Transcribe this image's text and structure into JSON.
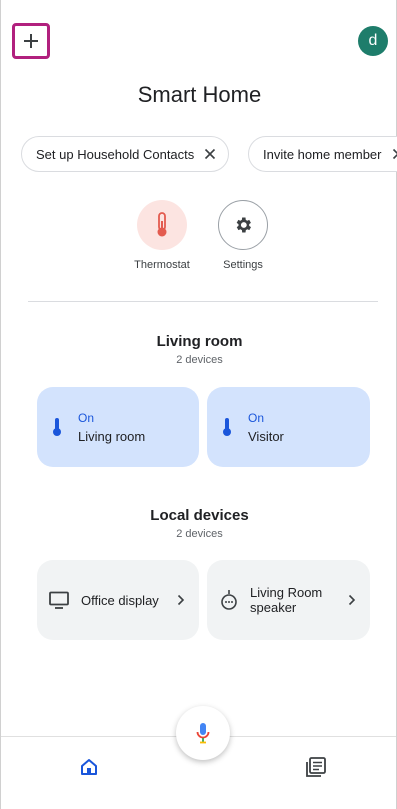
{
  "header": {
    "title": "Smart Home",
    "avatar_initial": "d"
  },
  "chips": [
    {
      "label": "Set up Household Contacts"
    },
    {
      "label": "Invite home member"
    }
  ],
  "shortcuts": [
    {
      "label": "Thermostat",
      "icon": "thermometer-icon"
    },
    {
      "label": "Settings",
      "icon": "gear-icon"
    }
  ],
  "rooms": [
    {
      "title": "Living room",
      "subtitle": "2 devices",
      "devices": [
        {
          "state": "On",
          "name": "Living room",
          "icon": "thermometer-icon"
        },
        {
          "state": "On",
          "name": "Visitor",
          "icon": "thermometer-icon"
        }
      ]
    },
    {
      "title": "Local devices",
      "subtitle": "2 devices",
      "devices": [
        {
          "name": "Office display",
          "icon": "monitor-icon"
        },
        {
          "name_line1": "Living Room",
          "name_line2": "speaker",
          "icon": "speaker-icon"
        }
      ]
    }
  ],
  "nav": {
    "home_icon": "home-icon",
    "feed_icon": "feed-icon",
    "mic_icon": "microphone-icon"
  },
  "colors": {
    "accent_blue": "#1a56db",
    "card_on": "#d3e3fd",
    "card_off": "#f1f3f4",
    "avatar": "#1e7d6b",
    "highlight_border": "#b1207e",
    "thermostat_red": "#e35b4f"
  }
}
